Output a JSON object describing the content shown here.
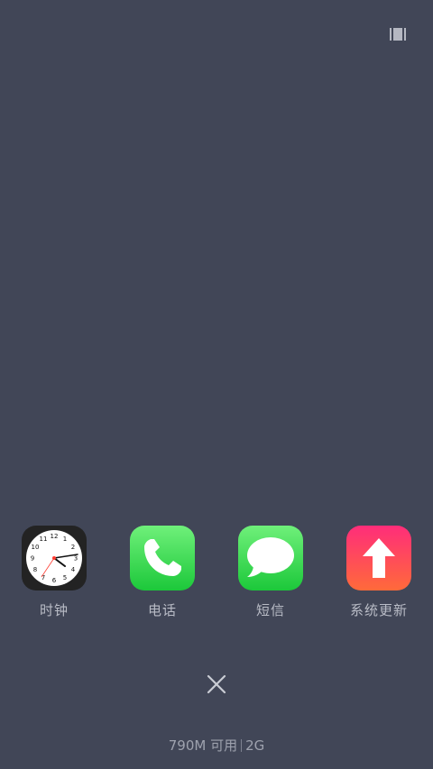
{
  "apps": [
    {
      "label": "时钟",
      "icon": "clock-icon"
    },
    {
      "label": "电话",
      "icon": "phone-icon"
    },
    {
      "label": "短信",
      "icon": "messages-icon"
    },
    {
      "label": "系统更新",
      "icon": "system-update-icon"
    }
  ],
  "clock_face": {
    "numbers": [
      "12",
      "1",
      "2",
      "3",
      "4",
      "5",
      "6",
      "7",
      "8",
      "9",
      "10",
      "11"
    ]
  },
  "memory": {
    "available": "790M 可用",
    "total": "2G"
  },
  "colors": {
    "background": "#414657",
    "label": "#b9bcc6",
    "phone_green": "#1cc83a",
    "update_pink": "#ff2d7a"
  }
}
